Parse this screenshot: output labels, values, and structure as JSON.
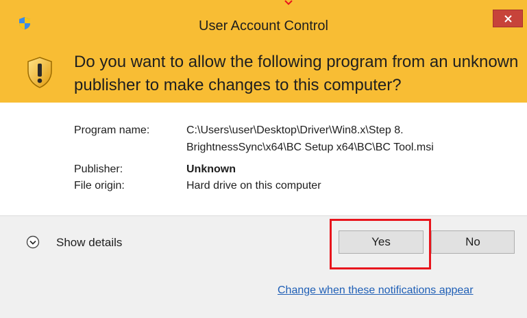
{
  "window": {
    "title": "User Account Control",
    "close_icon": "close-icon"
  },
  "banner": {
    "icon": "warning-shield-icon",
    "question": "Do you want to allow the following program from an unknown publisher to make changes to this computer?"
  },
  "details": {
    "program_name_label": "Program name:",
    "program_name_line1": "C:\\Users\\user\\Desktop\\Driver\\Win8.x\\Step 8.",
    "program_name_line2": "BrightnessSync\\x64\\BC Setup x64\\BC\\BC Tool.msi",
    "publisher_label": "Publisher:",
    "publisher_value": "Unknown",
    "file_origin_label": "File origin:",
    "file_origin_value": "Hard drive on this computer"
  },
  "footer": {
    "show_details_label": "Show details",
    "yes_label": "Yes",
    "no_label": "No",
    "change_link": "Change when these notifications appear"
  },
  "colors": {
    "banner_bg": "#f8bd34",
    "close_button_bg": "#c7433a",
    "highlight": "#e8141c",
    "link": "#1f5fb6"
  }
}
